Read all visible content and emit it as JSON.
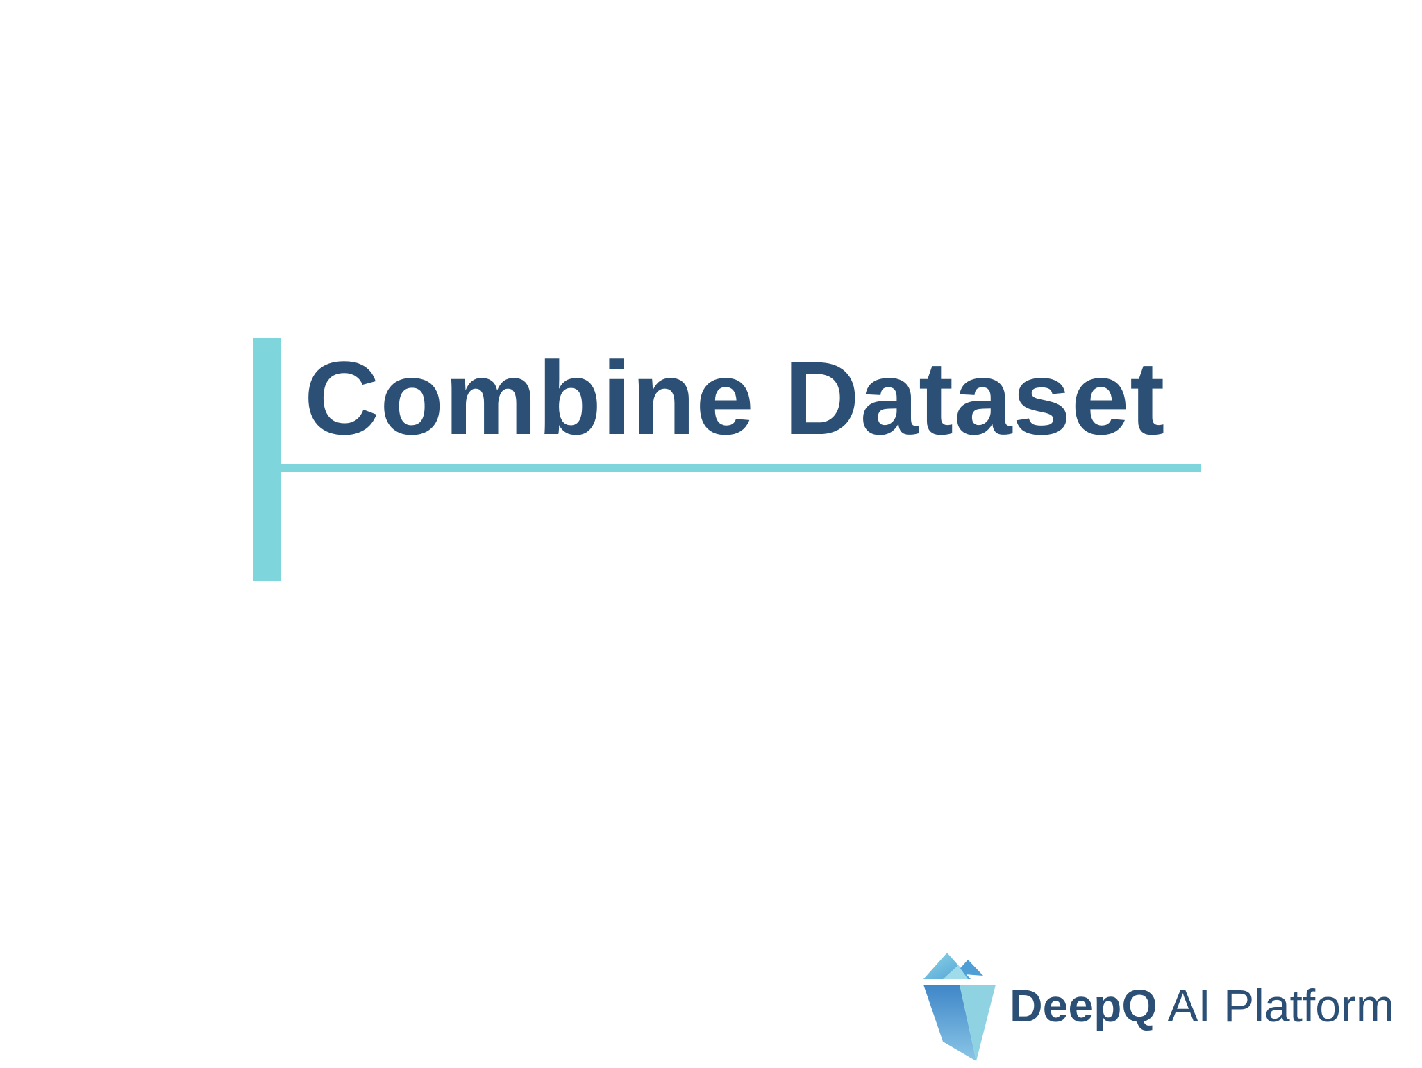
{
  "slide": {
    "title": "Combine Dataset"
  },
  "brand": {
    "name_bold": "DeepQ",
    "name_regular": "AI Platform",
    "logo_icon": "iceberg-logo-icon"
  },
  "colors": {
    "accent": "#7fd5dc",
    "title_text": "#2c5075",
    "background": "#ffffff"
  }
}
